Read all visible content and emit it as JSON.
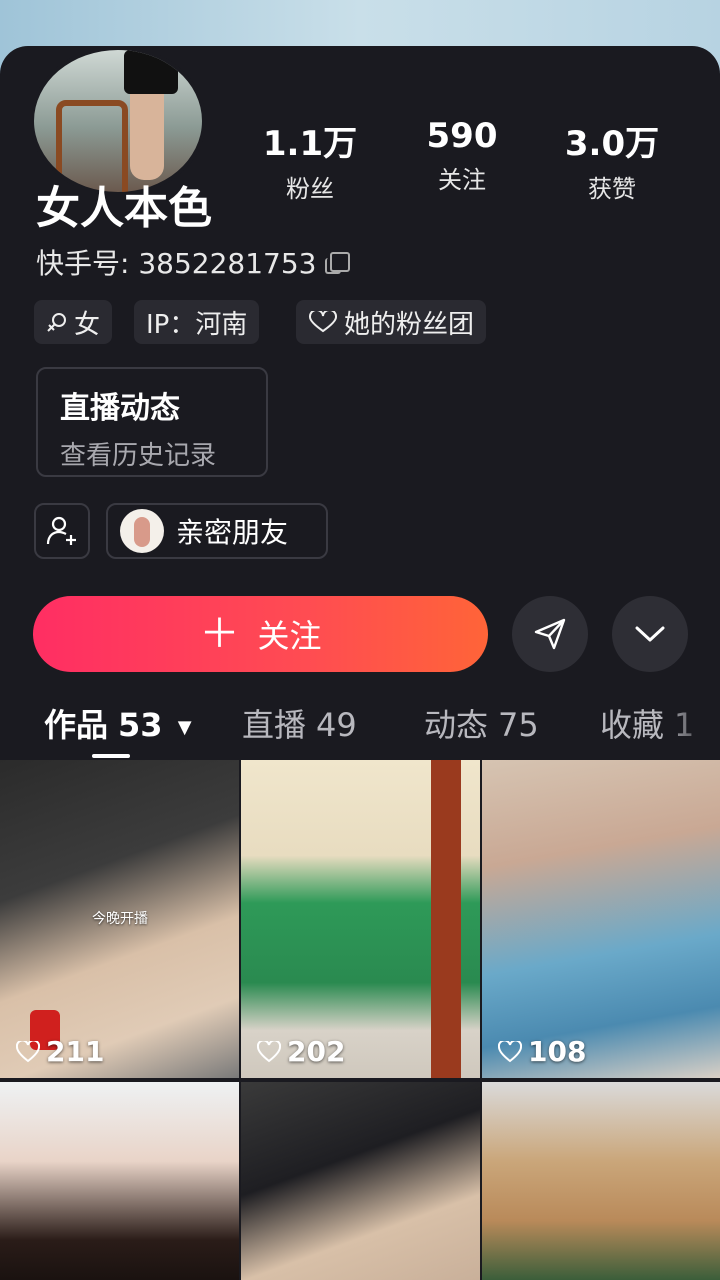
{
  "profile": {
    "name": "女人本色",
    "kuaishou_id": "快手号: 3852281753",
    "stats": [
      {
        "value": "1.1万",
        "label": "粉丝"
      },
      {
        "value": "590",
        "label": "关注"
      },
      {
        "value": "3.0万",
        "label": "获赞"
      }
    ],
    "tags": [
      {
        "label": "女",
        "icon": "female-icon"
      },
      {
        "label": "IP：河南",
        "icon": ""
      },
      {
        "label": "她的粉丝团",
        "icon": "heart-icon"
      }
    ],
    "live_box": {
      "title": "直播动态",
      "subtitle": "查看历史记录"
    },
    "close_friend_label": "亲密朋友"
  },
  "actions": {
    "follow_label": "关注",
    "share_icon": "send-icon",
    "more_icon": "chevron-down-icon"
  },
  "tabs": [
    {
      "label": "作品",
      "count": "53"
    },
    {
      "label": "直播",
      "count": "49"
    },
    {
      "label": "动态",
      "count": "75"
    },
    {
      "label": "收藏",
      "count": "1"
    }
  ],
  "videos": [
    {
      "likes": "211",
      "overlay": "今晚开播"
    },
    {
      "likes": "202"
    },
    {
      "likes": "108"
    },
    {},
    {},
    {}
  ],
  "colors": {
    "background": "#1a1a20",
    "follow_gradient_start": "#ff2e63",
    "follow_gradient_end": "#ff6438"
  }
}
